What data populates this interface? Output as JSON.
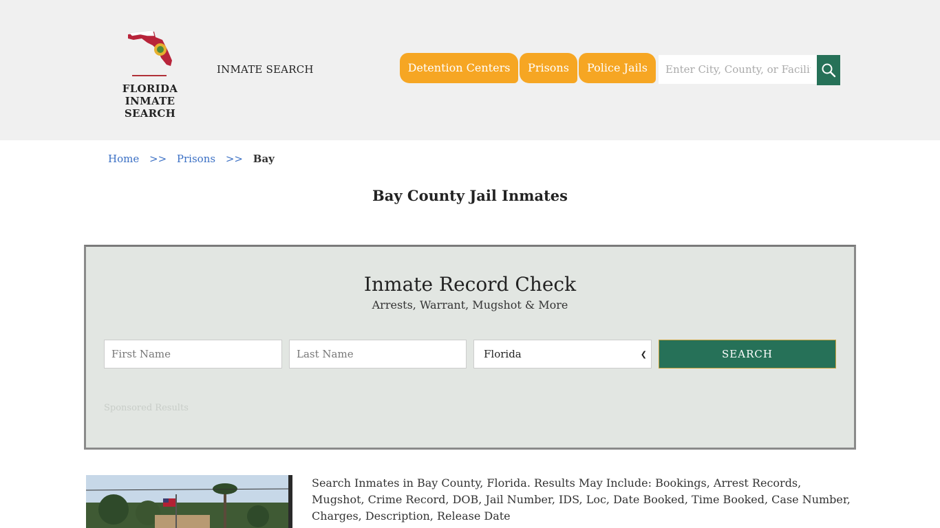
{
  "header": {
    "logo_line1": "FLORIDA",
    "logo_line2": "INMATE SEARCH",
    "site_title": "INMATE SEARCH",
    "nav": [
      {
        "label": "Detention Centers"
      },
      {
        "label": "Prisons"
      },
      {
        "label": "Police Jails"
      }
    ],
    "search": {
      "placeholder": "Enter City, County, or Facility"
    },
    "colors": {
      "accent": "#f6a623",
      "primary": "#267158",
      "background": "#f0f0f0"
    }
  },
  "breadcrumb": {
    "home": "Home",
    "sep1": ">>",
    "prisons": "Prisons",
    "sep2": ">>",
    "current": "Bay"
  },
  "page_title": "Bay County Jail Inmates",
  "record_check": {
    "title": "Inmate Record Check",
    "subtitle": "Arrests, Warrant, Mugshot & More",
    "first_name_placeholder": "First Name",
    "last_name_placeholder": "Last Name",
    "state_selected": "Florida",
    "search_label": "SEARCH",
    "sponsored": "Sponsored Results"
  },
  "description": "Search Inmates in Bay County, Florida. Results May Include: Bookings, Arrest Records, Mugshot, Crime Record, DOB, Jail Number, IDS, Loc, Date Booked, Time Booked, Case Number, Charges, Description, Release Date"
}
